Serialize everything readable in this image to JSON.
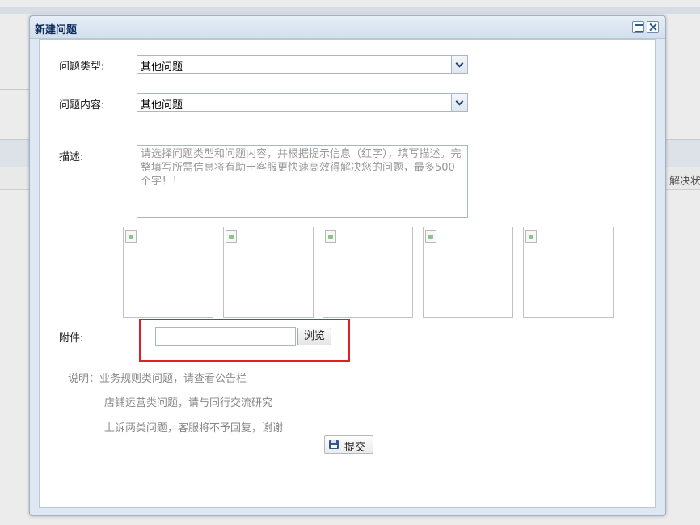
{
  "background": {
    "column_header": "解决状"
  },
  "dialog": {
    "title": "新建问题",
    "fields": {
      "type_label": "问题类型:",
      "type_value": "其他问题",
      "content_label": "问题内容:",
      "content_value": "其他问题",
      "desc_label": "描述:",
      "desc_placeholder": "请选择问题类型和问题内容，并根据提示信息（红字），填写描述。完整填写所需信息将有助于客服更快速高效得解决您的问题，最多500个字！！",
      "attachment_label": "附件:",
      "browse_label": "浏览"
    },
    "notes": [
      "说明：业务规则类问题，请查看公告栏",
      "店铺运营类问题，请与同行交流研究",
      "上诉两类问题，客服将不予回复，谢谢"
    ],
    "submit_label": "提交"
  },
  "icons": {
    "maximize": "maximize-icon",
    "close": "close-icon",
    "dropdown": "chevron-down-icon",
    "image_placeholder": "broken-image-icon",
    "save": "save-icon"
  },
  "colors": {
    "highlight_border": "#e02020",
    "title_text": "#0e2d5f"
  }
}
